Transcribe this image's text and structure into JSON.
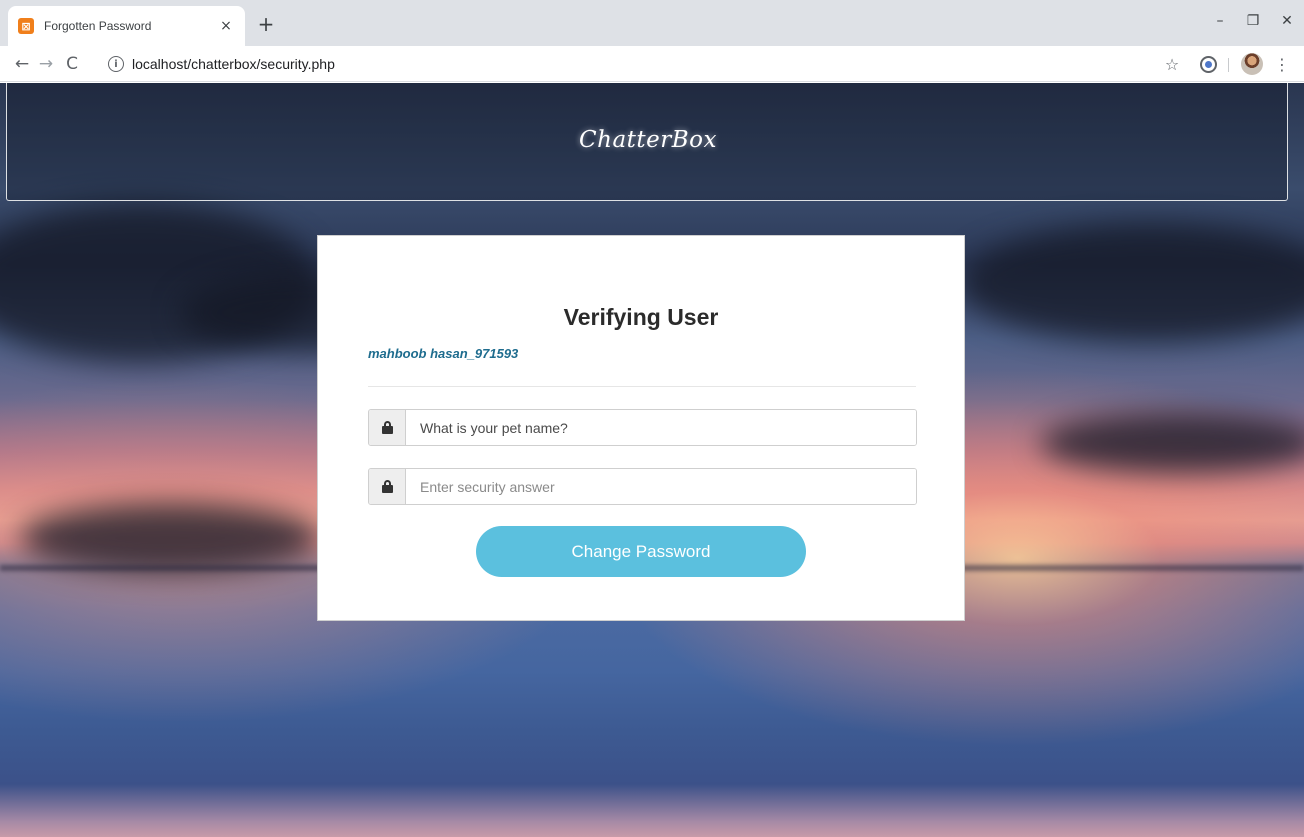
{
  "browser": {
    "tab_title": "Forgotten Password",
    "tab_favicon": "xampp-icon",
    "tab_close": "×",
    "new_tab": "+",
    "url": "localhost/chatterbox/security.php",
    "window_controls": {
      "minimize": "–",
      "maximize": "❐",
      "close": "✕"
    },
    "nav": {
      "back": "←",
      "forward": "→",
      "reload": "C"
    },
    "icons": {
      "star": "☆",
      "menu": "⋮",
      "info": "i",
      "favicon": "⊠"
    }
  },
  "header": {
    "logo_text": "ChatterBox"
  },
  "form": {
    "title": "Verifying User",
    "username": "mahboob hasan_971593",
    "question_value": "What is your pet name?",
    "answer_placeholder": "Enter security answer",
    "submit_label": "Change Password"
  },
  "colors": {
    "accent_button": "#5bc0de",
    "username_text": "#1e6c8e",
    "favicon": "#f07f1b"
  }
}
